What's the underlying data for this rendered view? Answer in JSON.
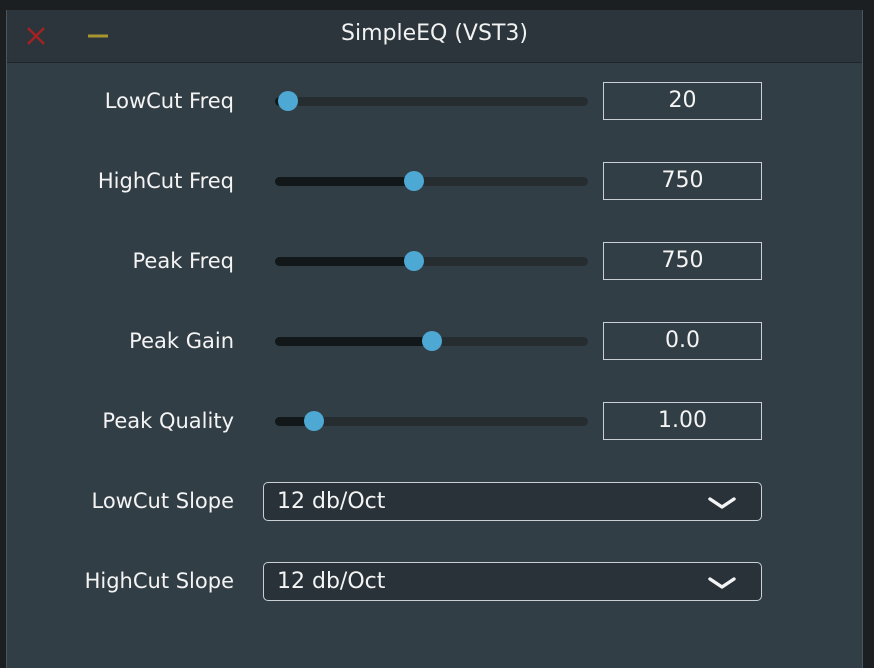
{
  "window": {
    "title": "SimpleEQ (VST3)",
    "close_icon": "close-x-icon",
    "minimize_icon": "minimize-dash-icon"
  },
  "controls": [
    {
      "label": "LowCut Freq",
      "value": "20",
      "level": 0.01
    },
    {
      "label": "HighCut Freq",
      "value": "750",
      "level": 0.44
    },
    {
      "label": "Peak Freq",
      "value": "750",
      "level": 0.44
    },
    {
      "label": "Peak Gain",
      "value": "0.0",
      "level": 0.5
    },
    {
      "label": "Peak Quality",
      "value": "1.00",
      "level": 0.1
    }
  ],
  "dropdowns": [
    {
      "label": "LowCut Slope",
      "selected": "12 db/Oct",
      "icon": "chevron-down-icon"
    },
    {
      "label": "HighCut Slope",
      "selected": "12 db/Oct",
      "icon": "chevron-down-icon"
    }
  ],
  "colors": {
    "accent": "#4da8d4",
    "close": "#a52222",
    "minimize": "#a89530"
  }
}
